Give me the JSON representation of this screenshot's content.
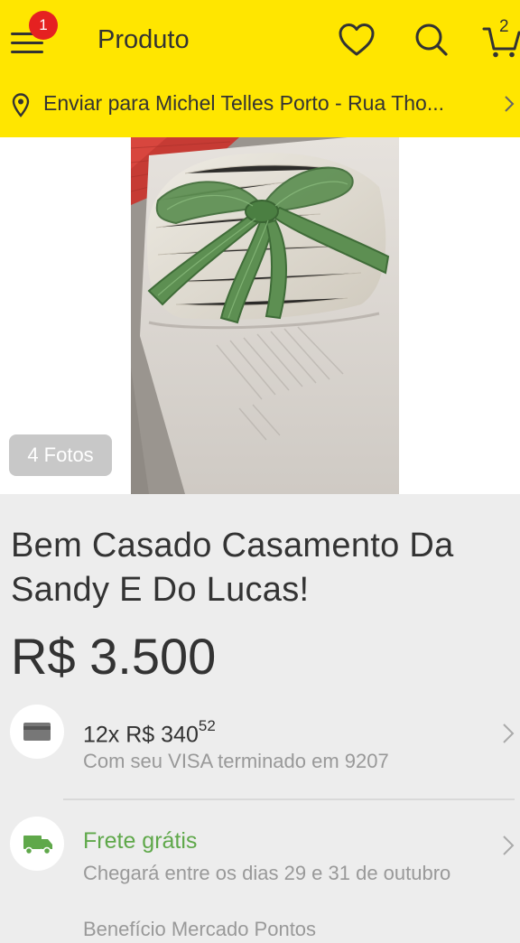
{
  "header": {
    "title": "Produto",
    "notification_count": "1",
    "cart_count": "2",
    "menu_icon": "hamburger-menu-icon",
    "favorite_icon": "heart-icon",
    "search_icon": "search-icon",
    "cart_icon": "cart-icon"
  },
  "shipping_location": {
    "text": "Enviar para Michel Telles Porto - Rua Tho...",
    "icon": "location-pin-icon"
  },
  "gallery": {
    "photo_count_label": "4 Fotos"
  },
  "product": {
    "title": "Bem Casado Casamento Da Sandy E Do Lucas!",
    "price": "R$ 3.500"
  },
  "installments": {
    "prefix": "12x R$ 340",
    "cents": "52",
    "card_note": "Com seu VISA terminado em 9207",
    "icon": "credit-card-icon"
  },
  "shipping": {
    "label": "Frete grátis",
    "arrival": "Chegará entre os dias 29 e 31 de outubro",
    "benefit_partial": "Benefício Mercado Pontos",
    "icon": "delivery-truck-icon"
  },
  "colors": {
    "header_bg": "#ffe600",
    "badge": "#e52121",
    "free_shipping": "#5fa84a",
    "page_bg": "#ededed"
  }
}
